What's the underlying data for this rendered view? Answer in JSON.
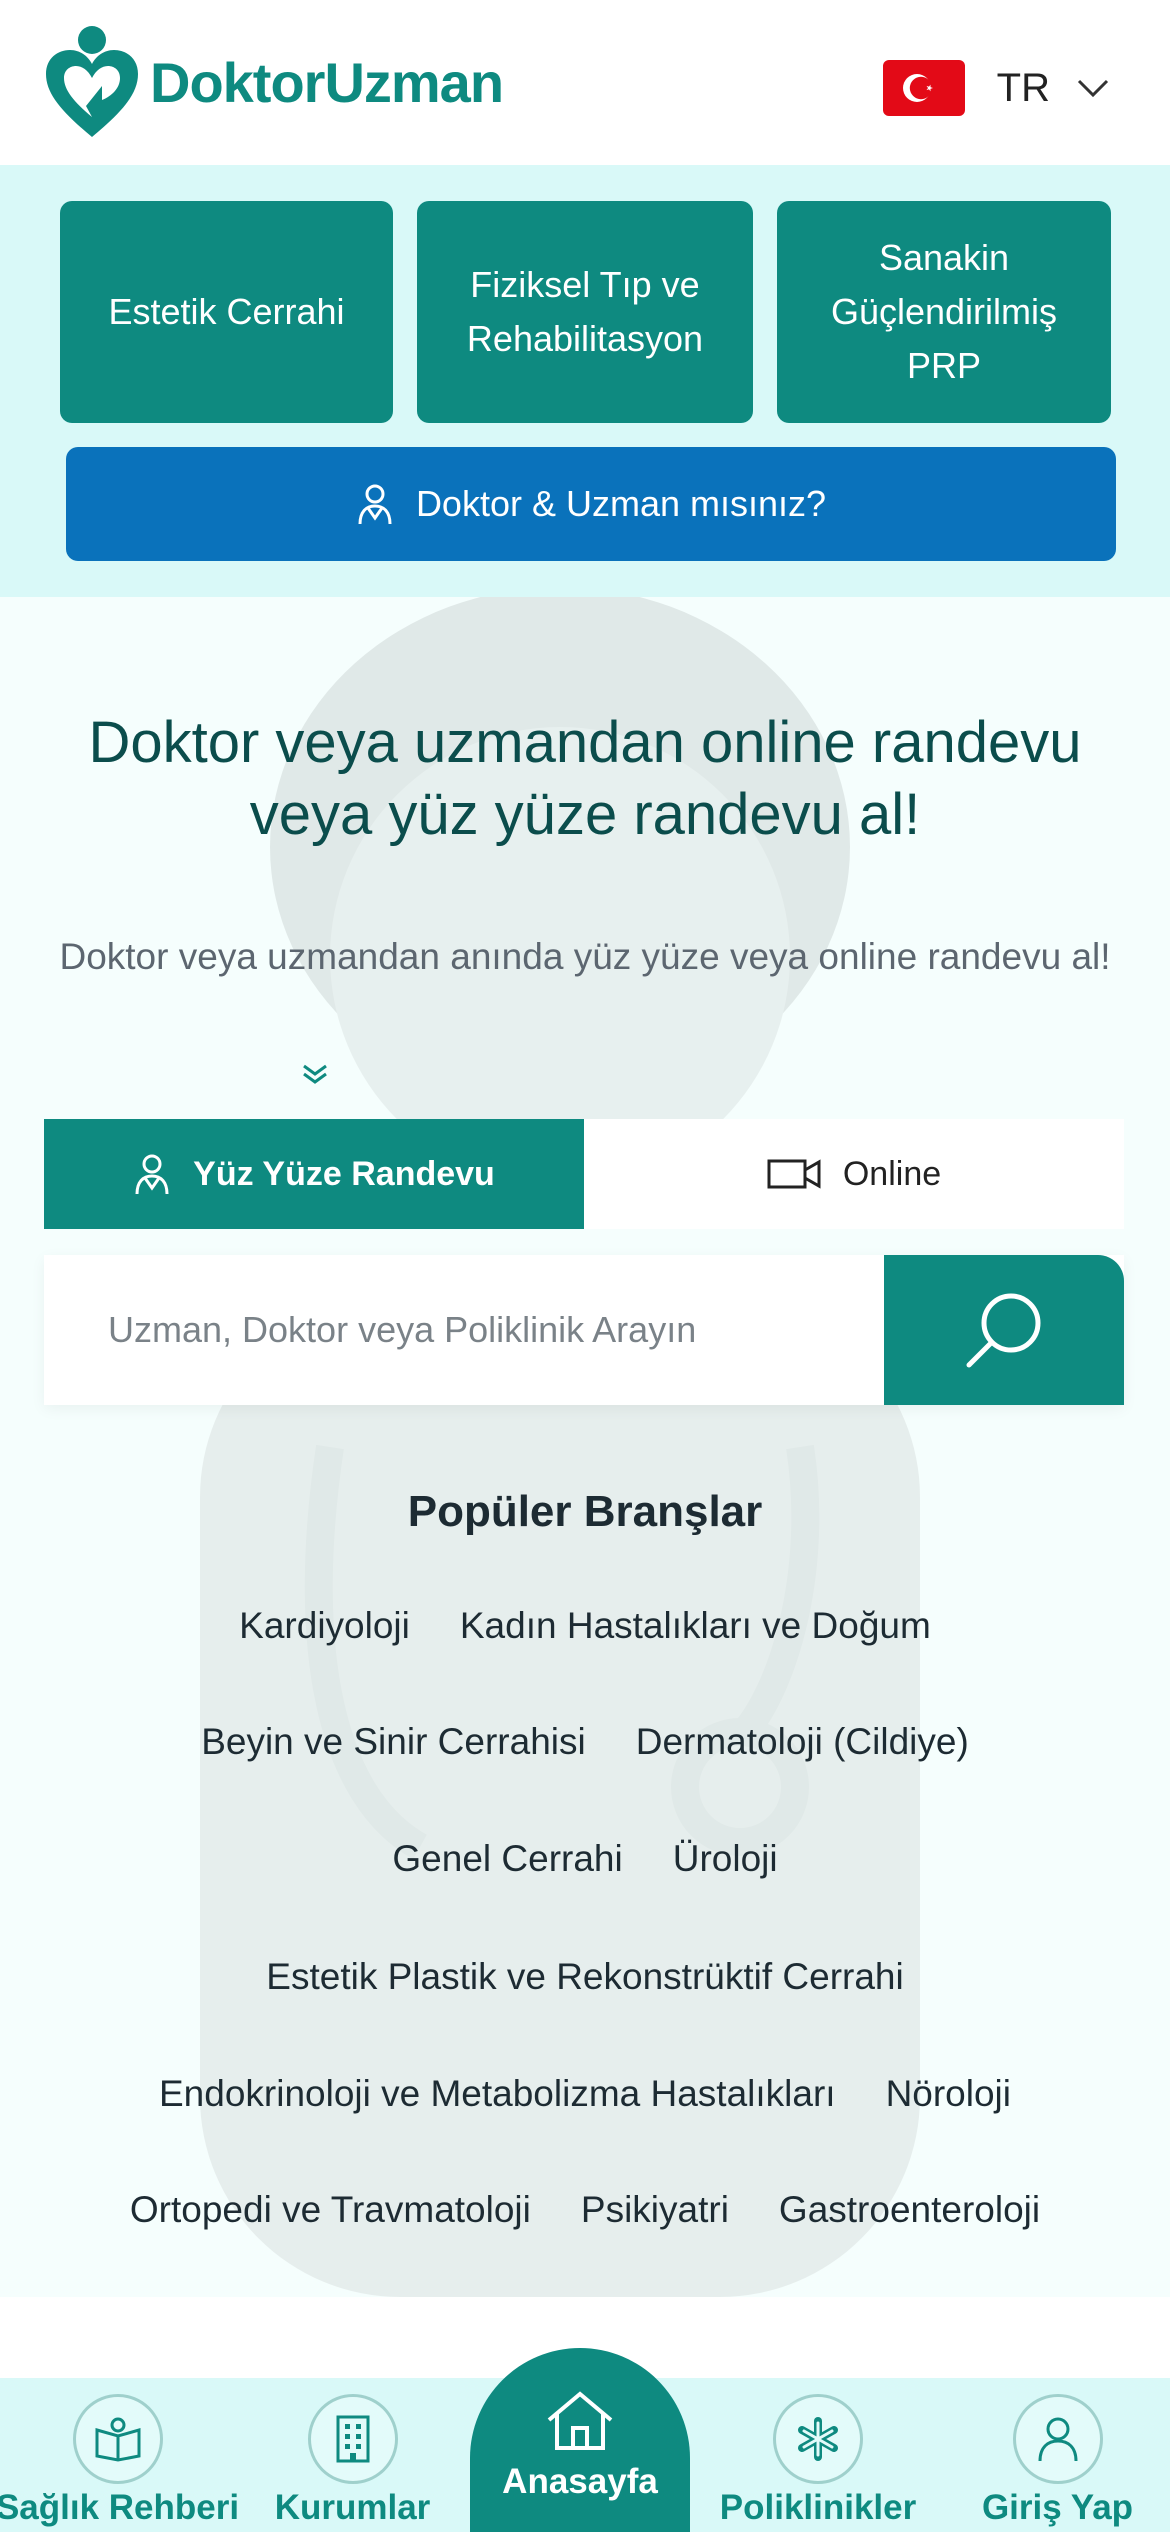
{
  "header": {
    "logo_text": "DoktorUzman",
    "language_code": "TR"
  },
  "categories": [
    {
      "label": "Estetik Cerrahi"
    },
    {
      "label": "Fiziksel Tıp ve Rehabilitasyon"
    },
    {
      "label": "Sanakin Güçlendirilmiş PRP"
    }
  ],
  "doctor_cta": {
    "label": "Doktor & Uzman mısınız?"
  },
  "hero": {
    "title": "Doktor veya uzmandan online randevu veya yüz yüze randevu al!",
    "subtitle": "Doktor veya uzmandan anında yüz yüze veya online randevu al!"
  },
  "tabs": {
    "in_person": "Yüz Yüze Randevu",
    "online": "Online"
  },
  "search": {
    "placeholder": "Uzman, Doktor veya Poliklinik Arayın"
  },
  "popular": {
    "title": "Popüler Branşlar",
    "rows": [
      [
        "Kardiyoloji",
        "Kadın Hastalıkları ve Doğum"
      ],
      [
        "Beyin ve Sinir Cerrahisi",
        "Dermatoloji (Cildiye)"
      ],
      [
        "Genel Cerrahi",
        "Üroloji"
      ],
      [
        "Estetik Plastik ve Rekonstrüktif Cerrahi"
      ],
      [
        "Endokrinoloji ve Metabolizma Hastalıkları",
        "Nöroloji"
      ],
      [
        "Ortopedi ve Travmatoloji",
        "Psikiyatri",
        "Gastroenteroloji"
      ]
    ]
  },
  "bottom_nav": {
    "health_guide": "Sağlık Rehberi",
    "institutions": "Kurumlar",
    "home": "Anasayfa",
    "clinics": "Poliklinikler",
    "login": "Giriş Yap"
  },
  "colors": {
    "brand_teal": "#0e8a80",
    "cta_blue": "#0a72bb",
    "band_bg": "#d9f9f8"
  }
}
